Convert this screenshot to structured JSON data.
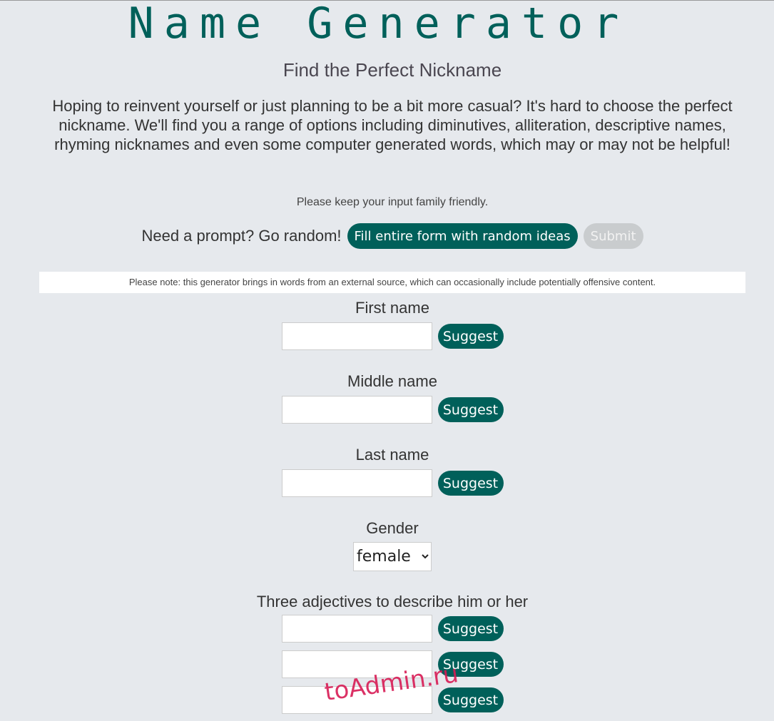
{
  "header": {
    "title": "Name Generator",
    "subtitle": "Find the Perfect Nickname"
  },
  "intro": "Hoping to reinvent yourself or just planning to be a bit more casual? It's hard to choose the perfect nickname. We'll find you a range of options including diminutives, alliteration, descriptive names, rhyming nicknames and even some computer generated words, which may or may not be helpful!",
  "family_note": "Please keep your input family friendly.",
  "prompt": {
    "text": "Need a prompt? Go random!",
    "random_label": "Fill entire form with random ideas",
    "submit_label": "Submit"
  },
  "offensive_note": "Please note: this generator brings in words from an external source, which can occasionally include potentially offensive content.",
  "fields": {
    "first": {
      "label": "First name",
      "value": "",
      "suggest": "Suggest"
    },
    "middle": {
      "label": "Middle name",
      "value": "",
      "suggest": "Suggest"
    },
    "last": {
      "label": "Last name",
      "value": "",
      "suggest": "Suggest"
    },
    "gender": {
      "label": "Gender",
      "selected": "female"
    },
    "adjectives": {
      "label": "Three adjectives to describe him or her",
      "suggest": "Suggest"
    }
  },
  "watermark": "toAdmin.ru",
  "colors": {
    "accent": "#00605a",
    "background": "#e6e9ed",
    "disabled": "#c9ccce"
  }
}
